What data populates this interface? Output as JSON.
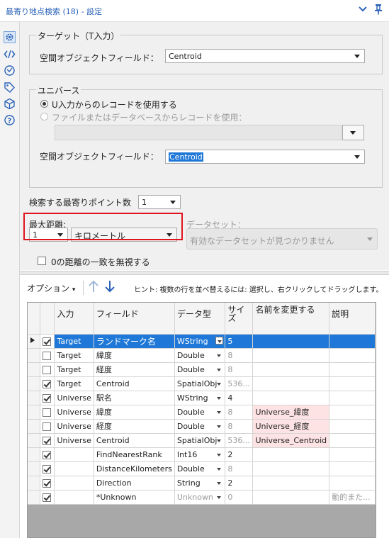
{
  "window": {
    "title": "最寄り地点検索 (18) - 設定"
  },
  "colors": {
    "accent": "#2a62b8",
    "selection": "#1f78d7",
    "highlight_box": "#e0141e",
    "rename_bg": "#fde3e3"
  },
  "target": {
    "group_label": "ターゲット（T入力）",
    "spatial_label": "空間オブジェクトフィールド：",
    "spatial_value": "Centroid"
  },
  "universe": {
    "group_label": "ユニバース",
    "option_u_input": "U入力からのレコードを使用する",
    "option_file": "ファイルまたはデータベースからレコードを使用：",
    "file_path": "",
    "spatial_label": "空間オブジェクトフィールド：",
    "spatial_value": "Centroid"
  },
  "nearest": {
    "label": "検索する最寄りポイント数",
    "value": "1"
  },
  "max_distance": {
    "label": "最大距離:",
    "value": "1",
    "unit": "キロメートル"
  },
  "dataset": {
    "label": "データセット：",
    "value": "有効なデータセットが見つかりません"
  },
  "ignore_zero": {
    "label": "0の距離の一致を無視する"
  },
  "toolbar": {
    "options_label": "オプション",
    "hint": "ヒント: 複数の行を並べ替えるには: 選択し、右クリックしてドラッグします。"
  },
  "grid": {
    "headers": {
      "input": "入力",
      "field": "フィールド",
      "type": "データ型",
      "size": "サイズ",
      "rename": "名前を変更する",
      "desc": "説明"
    },
    "rows": [
      {
        "checked": true,
        "input": "Target",
        "field": "ランドマーク名",
        "type": "WString",
        "size": "5",
        "rename": "",
        "desc": ""
      },
      {
        "checked": false,
        "input": "Target",
        "field": "緯度",
        "type": "Double",
        "size": "8",
        "rename": "",
        "desc": ""
      },
      {
        "checked": false,
        "input": "Target",
        "field": "経度",
        "type": "Double",
        "size": "8",
        "rename": "",
        "desc": ""
      },
      {
        "checked": true,
        "input": "Target",
        "field": "Centroid",
        "type": "SpatialObj",
        "size": "536...",
        "rename": "",
        "desc": ""
      },
      {
        "checked": true,
        "input": "Universe",
        "field": "駅名",
        "type": "WString",
        "size": "4",
        "rename": "",
        "desc": ""
      },
      {
        "checked": false,
        "input": "Universe",
        "field": "緯度",
        "type": "Double",
        "size": "8",
        "rename": "Universe_緯度",
        "desc": ""
      },
      {
        "checked": false,
        "input": "Universe",
        "field": "経度",
        "type": "Double",
        "size": "8",
        "rename": "Universe_経度",
        "desc": ""
      },
      {
        "checked": true,
        "input": "Universe",
        "field": "Centroid",
        "type": "SpatialObj",
        "size": "536...",
        "rename": "Universe_Centroid",
        "desc": ""
      },
      {
        "checked": true,
        "input": "",
        "field": "FindNearestRank",
        "type": "Int16",
        "size": "2",
        "rename": "",
        "desc": ""
      },
      {
        "checked": true,
        "input": "",
        "field": "DistanceKilometers",
        "type": "Double",
        "size": "8",
        "rename": "",
        "desc": ""
      },
      {
        "checked": true,
        "input": "",
        "field": "Direction",
        "type": "String",
        "size": "2",
        "rename": "",
        "desc": ""
      },
      {
        "checked": true,
        "input": "",
        "field": "*Unknown",
        "type": "Unknown",
        "size": "0",
        "rename": "",
        "desc": "動的また..."
      }
    ]
  }
}
